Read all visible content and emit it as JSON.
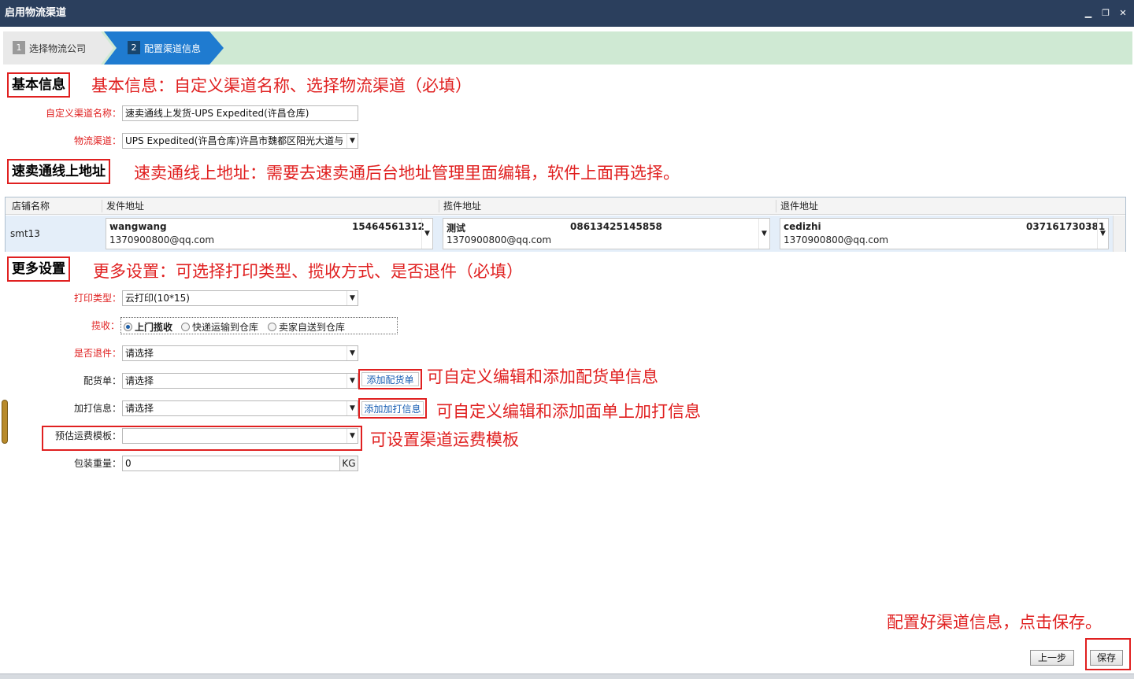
{
  "window": {
    "title": "启用物流渠道",
    "controls": [
      "minimize-icon",
      "restore-icon",
      "close-icon"
    ]
  },
  "steps": [
    {
      "num": "1",
      "label": "选择物流公司",
      "active": false
    },
    {
      "num": "2",
      "label": "配置渠道信息",
      "active": true
    }
  ],
  "basic": {
    "heading": "基本信息",
    "annotation": "基本信息：自定义渠道名称、选择物流渠道（必填）",
    "channel_name_label": "自定义渠道名称：",
    "channel_name_value": "速卖通线上发货-UPS Expedited(许昌仓库)",
    "logistics_label": "物流渠道：",
    "logistics_value": "UPS Expedited(许昌仓库)许昌市魏都区阳光大道与"
  },
  "address": {
    "heading": "速卖通线上地址",
    "annotation": "速卖通线上地址：需要去速卖通后台地址管理里面编辑，软件上面再选择。",
    "columns": [
      "店铺名称",
      "发件地址",
      "揽件地址",
      "退件地址"
    ],
    "row": {
      "store": "smt13",
      "sender": {
        "name": "wangwang",
        "phone": "15464561312",
        "email": "1370900800@qq.com"
      },
      "pickup": {
        "name": "测试",
        "phone": "08613425145858",
        "email": "1370900800@qq.com"
      },
      "return": {
        "name": "cedizhi",
        "phone": "037161730381",
        "email": "1370900800@qq.com"
      }
    }
  },
  "more": {
    "heading": "更多设置",
    "annotation": "更多设置：可选择打印类型、揽收方式、是否退件（必填）",
    "print_type_label": "打印类型：",
    "print_type_value": "云打印(10*15)",
    "pickup_label": "揽收：",
    "pickup_options": [
      "上门揽收",
      "快递运输到仓库",
      "卖家自送到仓库"
    ],
    "pickup_selected": 0,
    "return_label": "是否退件：",
    "return_value": "请选择",
    "packing_label": "配货单：",
    "packing_value": "请选择",
    "add_packing_label": "添加配货单",
    "packing_annotation": "可自定义编辑和添加配货单信息",
    "extra_label": "加打信息：",
    "extra_value": "请选择",
    "add_extra_label": "添加加打信息",
    "extra_annotation": "可自定义编辑和添加面单上加打信息",
    "freight_label": "预估运费模板：",
    "freight_value": "",
    "freight_annotation": "可设置渠道运费模板",
    "weight_label": "包装重量：",
    "weight_value": "0",
    "weight_unit": "KG"
  },
  "footer": {
    "annotation": "配置好渠道信息，点击保存。",
    "prev_label": "上一步",
    "save_label": "保存"
  },
  "colors": {
    "titlebar": "#2b3f5d",
    "stepbar": "#cfe9d3",
    "active_step": "#1f7bd0",
    "annotation": "#e02020",
    "link": "#1a5fb4"
  }
}
